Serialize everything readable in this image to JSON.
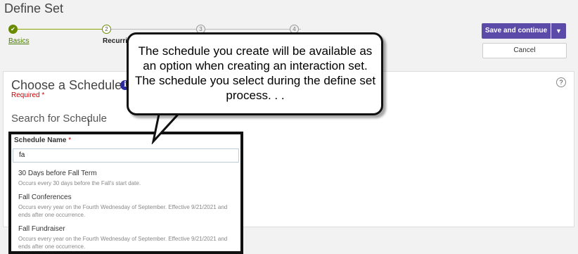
{
  "page": {
    "title": "Define Set"
  },
  "stepper": {
    "steps": [
      {
        "label": "Basics",
        "marker": "✔"
      },
      {
        "label": "Recurring",
        "marker": "2"
      },
      {
        "label": "",
        "marker": "3"
      },
      {
        "label": "",
        "marker": "4"
      }
    ]
  },
  "actions": {
    "save_label": "Save and continue",
    "cancel_label": "Cancel"
  },
  "section": {
    "title": "Choose a Schedule",
    "required_label": "Required",
    "search_heading": "Search for Schedule",
    "help": "?"
  },
  "schedule_field": {
    "label": "Schedule Name",
    "value": "fa",
    "results": [
      {
        "name": "30 Days before Fall Term",
        "description": "Occurs every 30 days before the Fall's start date."
      },
      {
        "name": "Fall Conferences",
        "description": "Occurs every year on the Fourth Wednesday of September. Effective 9/21/2021 and ends after one occurrence."
      },
      {
        "name": "Fall Fundraiser",
        "description": "Occurs every year on the Fourth Wednesday of September. Effective 9/21/2021 and ends after one occurrence."
      }
    ]
  },
  "callout": {
    "text": "The schedule you create will be available as an option when creating an interaction set. The schedule you select during the define set process. . ."
  },
  "colors": {
    "primary_button": "#5b4aa8",
    "step_complete": "#6a8a00",
    "required": "#cc0000"
  }
}
